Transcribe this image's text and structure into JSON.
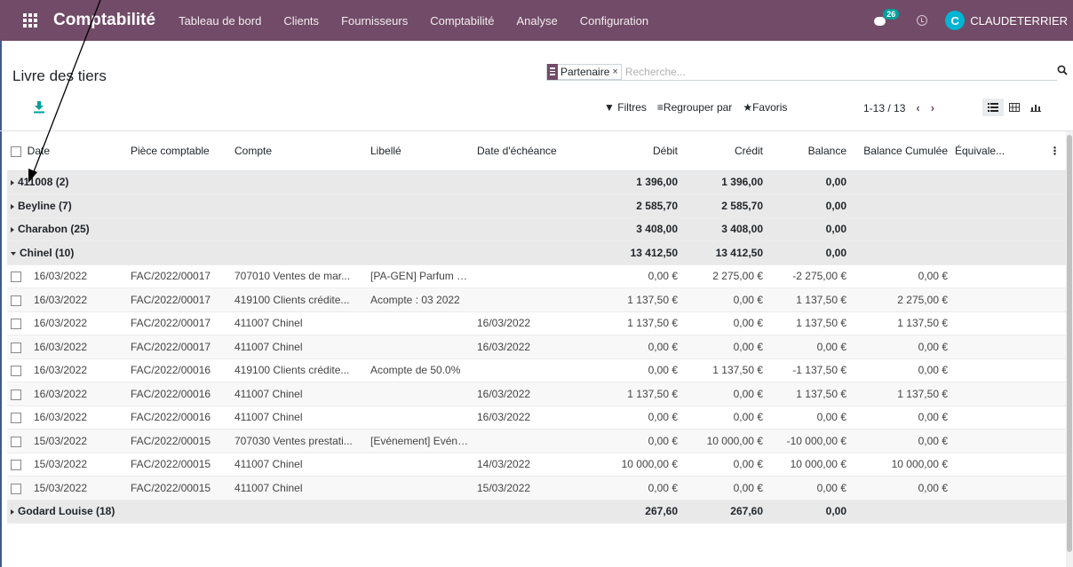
{
  "app": {
    "brand": "Comptabilité",
    "menu": [
      "Tableau de bord",
      "Clients",
      "Fournisseurs",
      "Comptabilité",
      "Analyse",
      "Configuration"
    ],
    "chat_count": "26",
    "avatar_letter": "C",
    "user": "CLAUDETERRIER",
    "accent": "#714b67"
  },
  "control": {
    "title": "Livre des tiers",
    "facet": "Partenaire",
    "facet_close": "×",
    "search_placeholder": "Recherche...",
    "filters": "Filtres",
    "group_by": "Regrouper par",
    "favorites": "Favoris",
    "pager": "1-13 / 13"
  },
  "table": {
    "headers": [
      "Date",
      "Pièce comptable",
      "Compte",
      "Libellé",
      "Date d'échéance",
      "Débit",
      "Crédit",
      "Balance",
      "Balance Cumulée",
      "Équivale..."
    ],
    "groups": [
      {
        "label": "411008 (2)",
        "debit": "1 396,00",
        "credit": "1 396,00",
        "balance": "0,00"
      },
      {
        "label": "Beyline (7)",
        "debit": "2 585,70",
        "credit": "2 585,70",
        "balance": "0,00"
      },
      {
        "label": "Charabon (25)",
        "debit": "3 408,00",
        "credit": "3 408,00",
        "balance": "0,00"
      },
      {
        "label": "Chinel (10)",
        "debit": "13 412,50",
        "credit": "13 412,50",
        "balance": "0,00"
      }
    ],
    "rows": [
      {
        "date": "16/03/2022",
        "piece": "FAC/2022/00017",
        "compte": "707010 Ventes de mar...",
        "libelle": "[PA-GEN] Parfum Geniè...",
        "echeance": "",
        "debit": "0,00 €",
        "credit": "2 275,00 €",
        "balance": "-2 275,00 €",
        "cumul": "0,00 €"
      },
      {
        "date": "16/03/2022",
        "piece": "FAC/2022/00017",
        "compte": "419100 Clients crédite...",
        "libelle": "Acompte : 03 2022",
        "echeance": "",
        "debit": "1 137,50 €",
        "credit": "0,00 €",
        "balance": "1 137,50 €",
        "cumul": "2 275,00 €"
      },
      {
        "date": "16/03/2022",
        "piece": "FAC/2022/00017",
        "compte": "411007 Chinel",
        "libelle": "",
        "echeance": "16/03/2022",
        "debit": "1 137,50 €",
        "credit": "0,00 €",
        "balance": "1 137,50 €",
        "cumul": "1 137,50 €"
      },
      {
        "date": "16/03/2022",
        "piece": "FAC/2022/00017",
        "compte": "411007 Chinel",
        "libelle": "",
        "echeance": "16/03/2022",
        "debit": "0,00 €",
        "credit": "0,00 €",
        "balance": "0,00 €",
        "cumul": "0,00 €"
      },
      {
        "date": "16/03/2022",
        "piece": "FAC/2022/00016",
        "compte": "419100 Clients crédite...",
        "libelle": "Acompte de 50.0%",
        "echeance": "",
        "debit": "0,00 €",
        "credit": "1 137,50 €",
        "balance": "-1 137,50 €",
        "cumul": "0,00 €"
      },
      {
        "date": "16/03/2022",
        "piece": "FAC/2022/00016",
        "compte": "411007 Chinel",
        "libelle": "",
        "echeance": "16/03/2022",
        "debit": "1 137,50 €",
        "credit": "0,00 €",
        "balance": "1 137,50 €",
        "cumul": "1 137,50 €"
      },
      {
        "date": "16/03/2022",
        "piece": "FAC/2022/00016",
        "compte": "411007 Chinel",
        "libelle": "",
        "echeance": "16/03/2022",
        "debit": "0,00 €",
        "credit": "0,00 €",
        "balance": "0,00 €",
        "cumul": "0,00 €"
      },
      {
        "date": "15/03/2022",
        "piece": "FAC/2022/00015",
        "compte": "707030 Ventes prestati...",
        "libelle": "[Evénement] Evénemen...",
        "echeance": "",
        "debit": "0,00 €",
        "credit": "10 000,00 €",
        "balance": "-10 000,00 €",
        "cumul": "0,00 €"
      },
      {
        "date": "15/03/2022",
        "piece": "FAC/2022/00015",
        "compte": "411007 Chinel",
        "libelle": "",
        "echeance": "14/03/2022",
        "debit": "10 000,00 €",
        "credit": "0,00 €",
        "balance": "10 000,00 €",
        "cumul": "10 000,00 €"
      },
      {
        "date": "15/03/2022",
        "piece": "FAC/2022/00015",
        "compte": "411007 Chinel",
        "libelle": "",
        "echeance": "15/03/2022",
        "debit": "0,00 €",
        "credit": "0,00 €",
        "balance": "0,00 €",
        "cumul": "0,00 €"
      }
    ],
    "last_group": {
      "label": "Godard Louise (18)",
      "debit": "267,60",
      "credit": "267,60",
      "balance": "0,00"
    }
  }
}
